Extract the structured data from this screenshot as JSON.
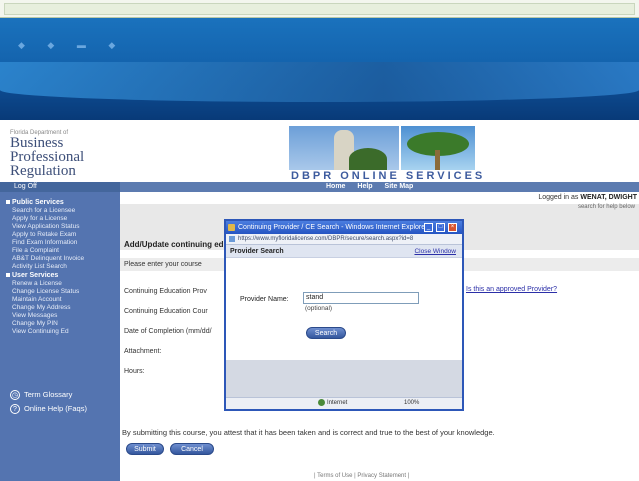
{
  "desktop": {
    "colors": {
      "sky": "#1a72bd",
      "brand_blue": "#3d5b9e"
    }
  },
  "site": {
    "logo": {
      "small": "Florida Department of",
      "line1": "Business",
      "line2": "Professional",
      "line3": "Regulation"
    },
    "brand": "DBPR ONLINE SERVICES",
    "logoff": "Log Off",
    "menu": [
      "Home",
      "Help",
      "Site Map"
    ],
    "logged_in_label": "Logged in as",
    "logged_in_user": "WENAT, DWIGHT",
    "subright": "search for help below",
    "sidebar": {
      "header1": "Public Services",
      "items1": [
        "Search for a Licensee",
        "Apply for a License",
        "View Application Status",
        "Apply to Retake Exam",
        "Find Exam Information",
        "File a Complaint",
        "AB&T Delinquent Invoice",
        "Activity List Search"
      ],
      "header2": "User Services",
      "items2": [
        "Renew a License",
        "Change License Status",
        "Maintain Account",
        "Change My Address",
        "View Messages",
        "Change My PIN",
        "View Continuing Ed"
      ],
      "bottom": [
        "Term Glossary",
        "Online Help (Faqs)"
      ]
    },
    "main": {
      "title": "Add/Update continuing education",
      "instructions": "Please enter your course",
      "field1": "Continuing Education Prov",
      "field2": "Continuing Education Cour",
      "field3": "Date of Completion (mm/dd/",
      "field4": "Attachment:",
      "field5": "Hours:",
      "link": "Is this an approved Provider?",
      "agree": "By submitting this course, you attest that it has been taken and is correct and true to the best of your knowledge.",
      "submit": "Submit",
      "cancel": "Cancel",
      "footer": "| Terms of Use | Privacy Statement |"
    }
  },
  "popup": {
    "title": "Continuing Provider / CE Search - Windows Internet Explorer",
    "address": "https://www.myfloridalicense.com/DBPR/secure/search.aspx?id=8",
    "header": "Provider Search",
    "close": "Close Window",
    "label": "Provider Name:",
    "value": "stand",
    "optional": "(optional)",
    "search": "Search",
    "status_internet": "Internet",
    "status_zoom": "100%"
  }
}
